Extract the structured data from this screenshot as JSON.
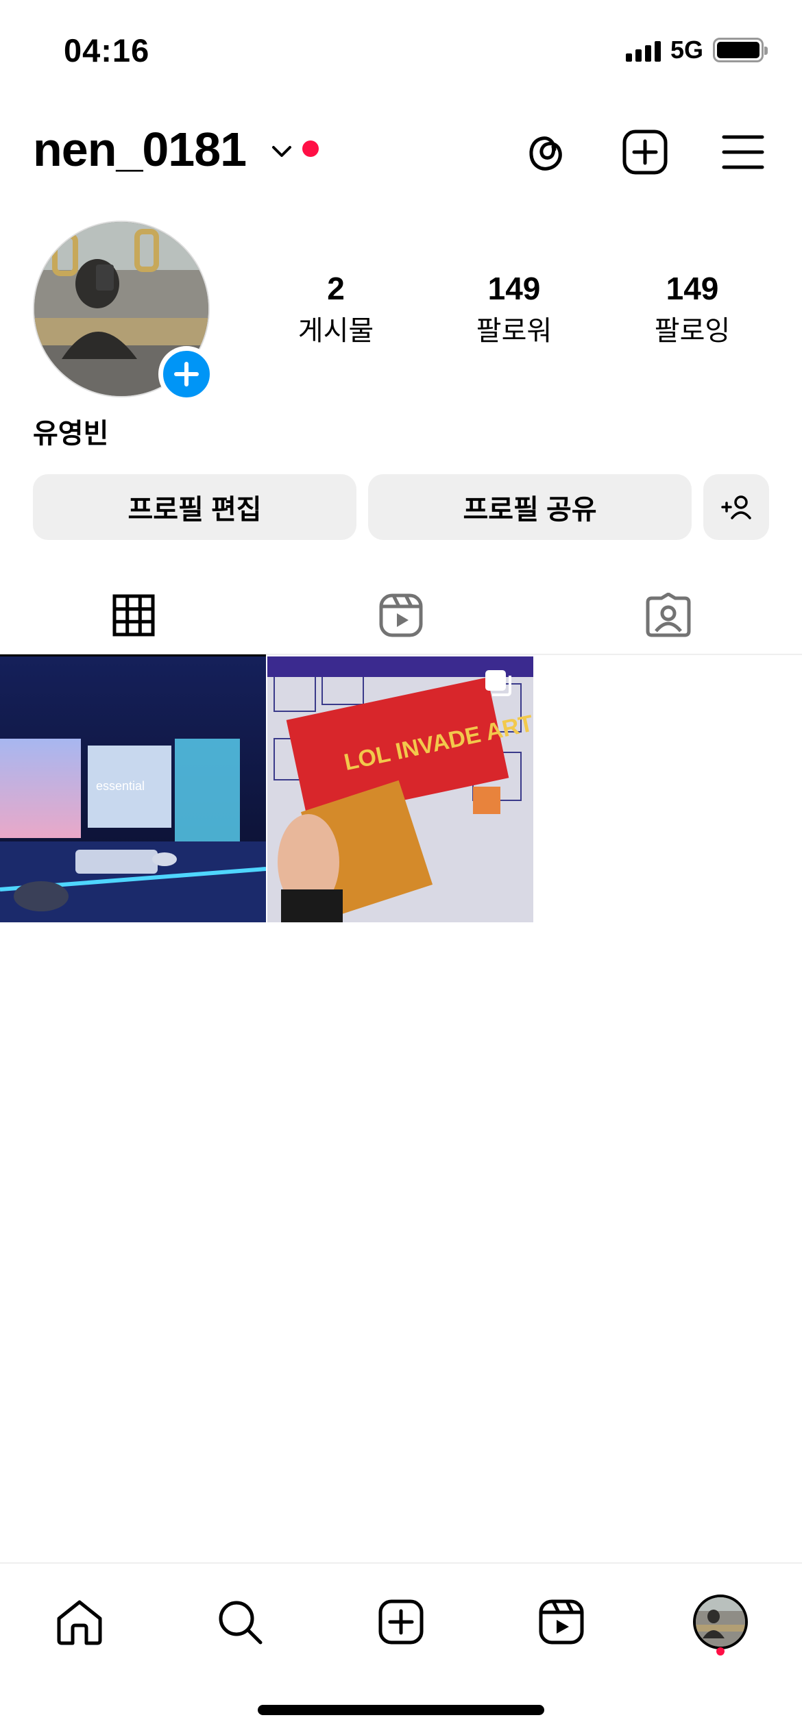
{
  "status_bar": {
    "time": "04:16",
    "network": "5G",
    "icons": [
      "cellular-signal-icon",
      "battery-icon"
    ]
  },
  "header": {
    "username": "nen_0181",
    "icons": [
      "chevron-down-icon",
      "threads-icon",
      "create-post-icon",
      "menu-icon"
    ],
    "notification_color": "#ff0f45"
  },
  "profile": {
    "display_name": "유영빈",
    "stats": [
      {
        "value": "2",
        "label": "게시물"
      },
      {
        "value": "149",
        "label": "팔로워"
      },
      {
        "value": "149",
        "label": "팔로잉"
      }
    ],
    "add_story_color": "#0095f6"
  },
  "buttons": {
    "edit_profile": "프로필 편집",
    "share_profile": "프로필 공유",
    "discover_people_icon": "add-person-icon"
  },
  "tabs": [
    {
      "name": "grid",
      "icon": "grid-icon",
      "active": true
    },
    {
      "name": "reels",
      "icon": "reels-icon",
      "active": false
    },
    {
      "name": "tagged",
      "icon": "tagged-icon",
      "active": false
    }
  ],
  "posts": [
    {
      "description_icon": "photo",
      "overlay_text": "essential",
      "multi": false
    },
    {
      "description_icon": "carousel-icon",
      "overlay_text": "LOL INVADE ART",
      "multi": true
    }
  ],
  "bottom_nav": {
    "items": [
      "home-icon",
      "search-icon",
      "create-icon",
      "reels-icon",
      "profile-avatar"
    ]
  }
}
